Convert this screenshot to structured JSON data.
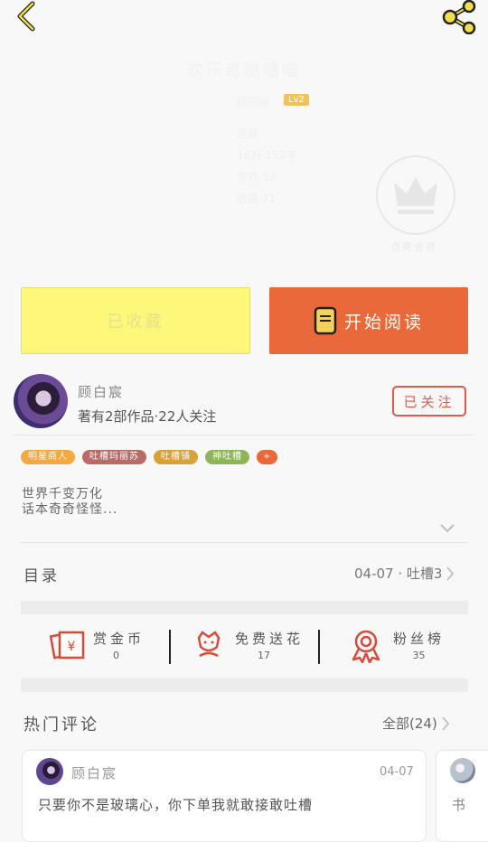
{
  "header": {
    "back_icon": "chevron-left-icon",
    "share_icon": "share-icon",
    "book_title": "欢乐奇哒嘈喵",
    "author_prefix": "顾白宸",
    "level": "Lv2",
    "meta_lines": [
      "连载",
      "16万·152字",
      "喜欢·5人",
      "收藏·31"
    ],
    "vip_label": "点亮会员"
  },
  "actions": {
    "collect_label": "已收藏",
    "read_label": "开始阅读",
    "colors": {
      "collect_bg": "#fdf77a",
      "read_bg": "#e9693a"
    }
  },
  "author": {
    "name": "顾白宸",
    "summary": "著有2部作品·22人关注",
    "follow_label": "已关注"
  },
  "tags": [
    {
      "label": "明星商人",
      "color": "#f4a93f"
    },
    {
      "label": "吐槽玛丽苏",
      "color": "#b96b67"
    },
    {
      "label": "吐槽铺",
      "color": "#d7a237"
    },
    {
      "label": "神吐槽",
      "color": "#8fb55a"
    },
    {
      "label": "+",
      "color": "#e9693a"
    }
  ],
  "intro": {
    "line1": "世界千变万化",
    "line2": "话本奇奇怪怪..."
  },
  "toc": {
    "label": "目录",
    "info": "04-07 · 吐槽3"
  },
  "stats": [
    {
      "title": "赏金币",
      "value": "0",
      "icon": "red-envelope-icon"
    },
    {
      "title": "免费送花",
      "value": "17",
      "icon": "flower-icon"
    },
    {
      "title": "粉丝榜",
      "value": "35",
      "icon": "medal-icon"
    }
  ],
  "comments": {
    "section_title": "热门评论",
    "all_label": "全部(24)",
    "items": [
      {
        "user": "顾白宸",
        "date": "04-07",
        "text": "只要你不是玻璃心，你下单我就敢接敢吐槽"
      },
      {
        "text": "书"
      }
    ]
  }
}
